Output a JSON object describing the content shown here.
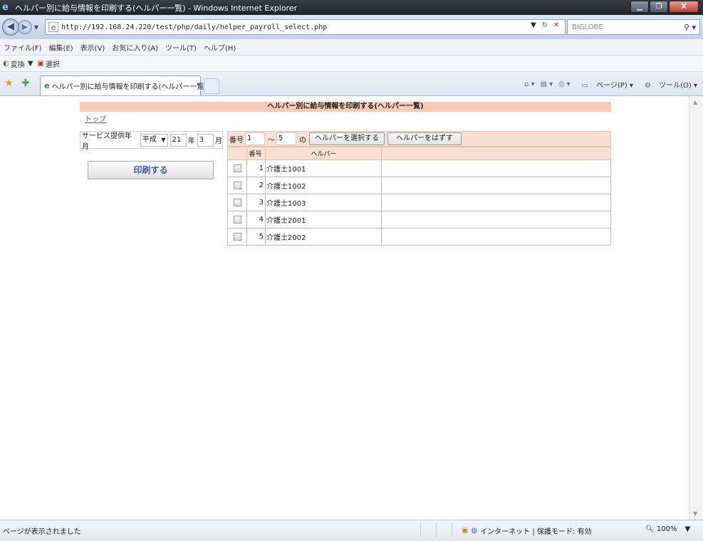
{
  "window": {
    "title": "ヘルパー別に給与情報を印刷する(ヘルパー一覧) - Windows Internet Explorer"
  },
  "address": {
    "url": "http://192.168.24.220/test/php/daily/helper_payroll_select.php",
    "search_placeholder": "BIGLOBE"
  },
  "menu": [
    "ファイル(F)",
    "編集(E)",
    "表示(V)",
    "お気に入り(A)",
    "ツール(T)",
    "ヘルプ(H)"
  ],
  "cmdbar": {
    "convert": "変換",
    "select": "選択"
  },
  "tab": {
    "label": "ヘルパー別に給与情報を印刷する(ヘルパー一覧)"
  },
  "tools": {
    "page": "ページ(P)",
    "tools": "ツール(O)"
  },
  "page": {
    "header": "ヘルパー別に給与情報を印刷する(ヘルパー一覧)",
    "top_link": "トップ",
    "service_label": "サービス提供年月",
    "era": "平成",
    "year": "21",
    "year_unit": "年",
    "month": "3",
    "month_unit": "月",
    "print_button": "印刷する",
    "range_label": "番号",
    "range_from": "1",
    "range_tilde": "～",
    "range_to": "5",
    "range_no": "の",
    "select_button": "ヘルパーを選択する",
    "unselect_button": "ヘルパーをはずす",
    "table_headers": [
      "番号",
      "ヘルパー"
    ],
    "helpers": [
      {
        "num": "1",
        "name": "介護士1001"
      },
      {
        "num": "2",
        "name": "介護士1002"
      },
      {
        "num": "3",
        "name": "介護士1003"
      },
      {
        "num": "4",
        "name": "介護士2001"
      },
      {
        "num": "5",
        "name": "介護士2002"
      }
    ]
  },
  "status": {
    "text": "ページが表示されました",
    "zone": "インターネット | 保護モード: 有効",
    "zoom": "100%"
  }
}
